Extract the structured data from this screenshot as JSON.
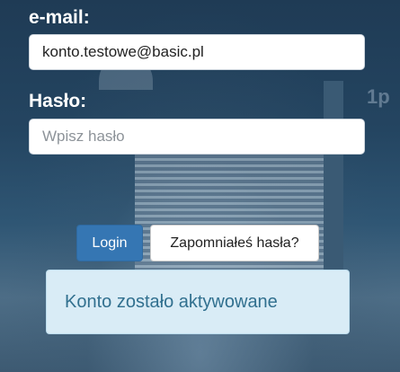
{
  "login_form": {
    "email_label": "e-mail:",
    "email_value": "konto.testowe@basic.pl",
    "password_label": "Hasło:",
    "password_placeholder": "Wpisz hasło",
    "login_button": "Login",
    "forgot_button": "Zapomniałeś hasła?"
  },
  "alert": {
    "message": "Konto zostało aktywowane"
  },
  "colors": {
    "login_button_bg": "#3576b3",
    "alert_bg": "#d9ecf6",
    "alert_text": "#31708f"
  }
}
